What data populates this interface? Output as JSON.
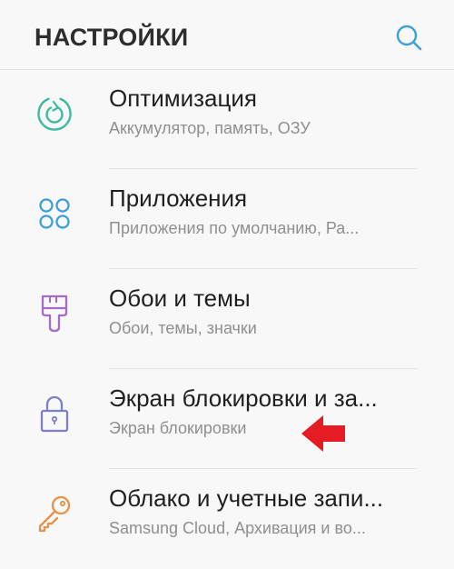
{
  "header": {
    "title": "НАСТРОЙКИ",
    "search_icon": "search-icon"
  },
  "items": [
    {
      "icon": "optimization-icon",
      "color": "#3dbba0",
      "title": "Оптимизация",
      "subtitle": "Аккумулятор, память, ОЗУ"
    },
    {
      "icon": "apps-grid-icon",
      "color": "#3ca0d6",
      "title": "Приложения",
      "subtitle": "Приложения по умолчанию, Ра..."
    },
    {
      "icon": "paint-brush-icon",
      "color": "#a46bc9",
      "title": "Обои и темы",
      "subtitle": "Обои, темы, значки"
    },
    {
      "icon": "lock-icon",
      "color": "#7d7fc9",
      "title": "Экран блокировки и за...",
      "subtitle": "Экран блокировки"
    },
    {
      "icon": "key-icon",
      "color": "#e7914a",
      "title": "Облако и учетные запи...",
      "subtitle": "Samsung Cloud, Архивация и во..."
    }
  ],
  "annotation": {
    "arrow_color": "#e51c23",
    "arrow_icon": "red-arrow-left-icon"
  }
}
